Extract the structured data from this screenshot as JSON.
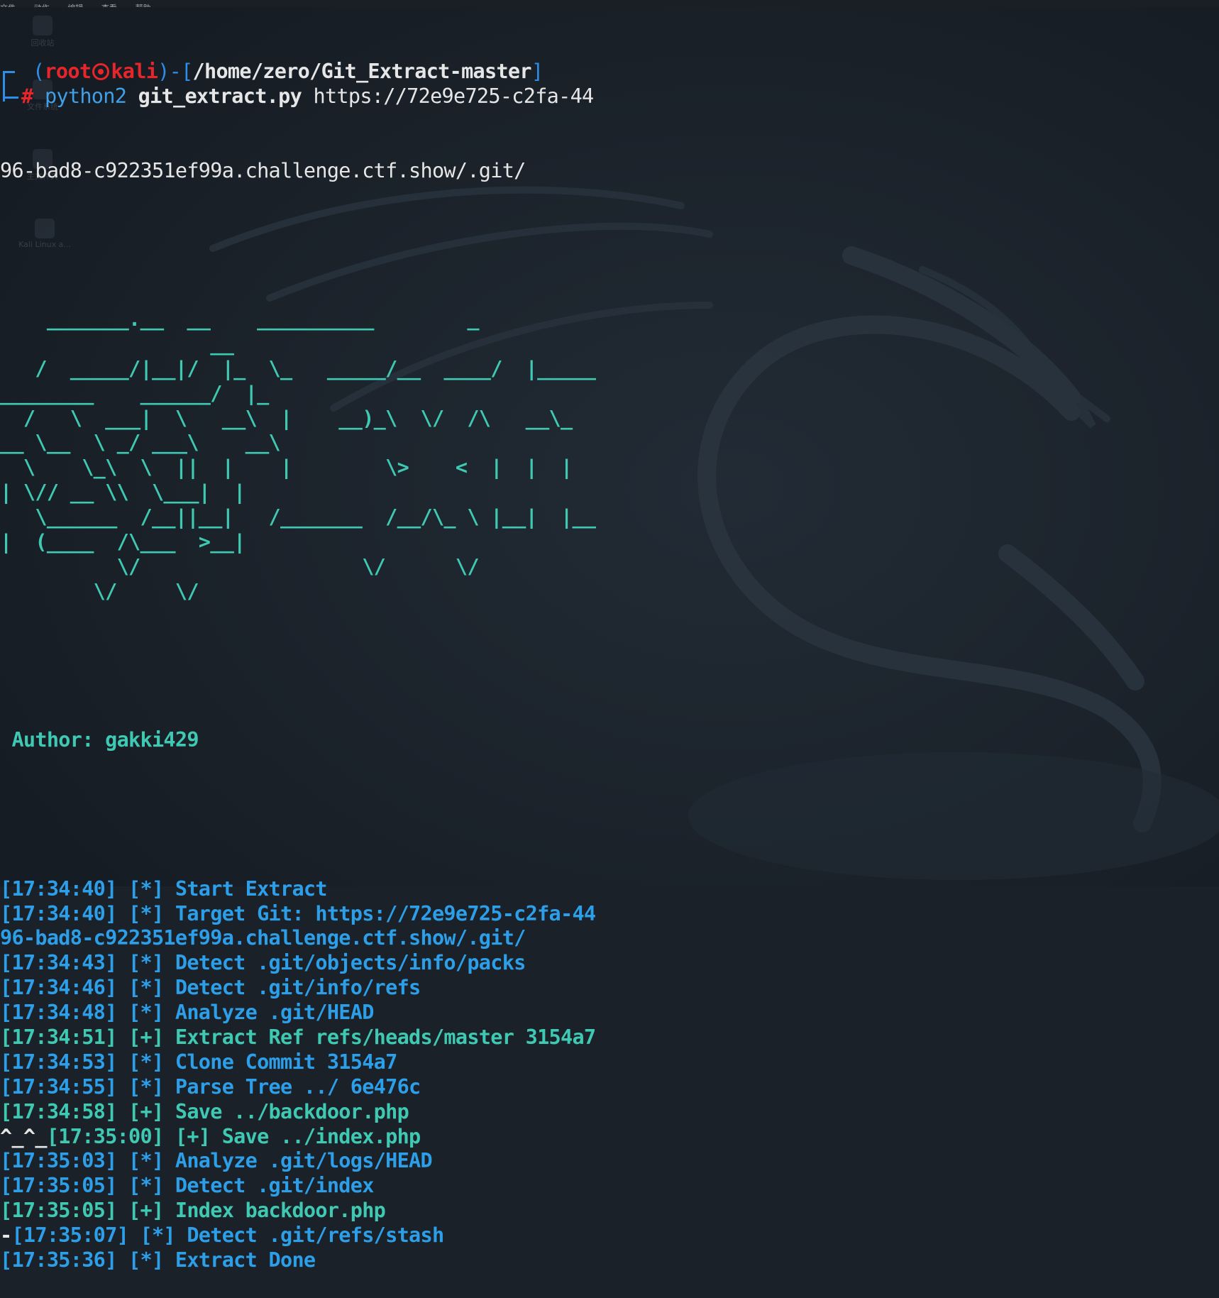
{
  "menubar": {
    "items": [
      "文件",
      "动作",
      "编辑",
      "查看",
      "帮助"
    ]
  },
  "desktop": {
    "icons": [
      "回收站",
      "文件系统",
      "主文件夹",
      "Kali Linux a..."
    ]
  },
  "prompt": {
    "open_paren": "(",
    "user": "root",
    "host": "kali",
    "close_paren_dash": ")-[",
    "path": "/home/zero/Git_Extract-master",
    "close_bracket": "]",
    "hash": "#",
    "tool": "python2",
    "script": "git_extract.py",
    "args": "https://72e9e725-c2fa-44",
    "args_wrap": "96-bad8-c922351ef99a.challenge.ctf.show/.git/"
  },
  "banner": [
    "    _______.__  __    __________        _",
    "                  __",
    "   /  _____/|__|/  |_  \\_   _____/__  ____/  |_____",
    "________    ______/  |_",
    "  /   \\  ___|  \\   __\\  |    __)_\\  \\/  /\\   __\\_",
    "__ \\__  \\ _/ ___\\    __\\",
    "  \\    \\_\\  \\  ||  |    |        \\>    <  |  |  |",
    "| \\// __ \\\\  \\___|  |",
    "   \\______  /__||__|   /_______  /__/\\_ \\ |__|  |__",
    "|  (____  /\\___  >__|",
    "          \\/                   \\/      \\/",
    "        \\/     \\/"
  ],
  "author": " Author: gakki429",
  "log": [
    {
      "text": "[17:34:40] [*] Start Extract",
      "color": "blue"
    },
    {
      "text": "[17:34:40] [*] Target Git: https://72e9e725-c2fa-44",
      "color": "blue"
    },
    {
      "text": "96-bad8-c922351ef99a.challenge.ctf.show/.git/",
      "color": "blue"
    },
    {
      "text": "[17:34:43] [*] Detect .git/objects/info/packs",
      "color": "blue"
    },
    {
      "text": "[17:34:46] [*] Detect .git/info/refs",
      "color": "blue"
    },
    {
      "text": "[17:34:48] [*] Analyze .git/HEAD",
      "color": "blue"
    },
    {
      "text": "[17:34:51] [+] Extract Ref refs/heads/master 3154a7",
      "color": "cyan"
    },
    {
      "text": "[17:34:53] [*] Clone Commit 3154a7",
      "color": "blue"
    },
    {
      "text": "[17:34:55] [*] Parse Tree ../ 6e476c",
      "color": "blue"
    },
    {
      "text": "[17:34:58] [+] Save ../backdoor.php",
      "color": "cyan"
    },
    {
      "prefix": "^_^_",
      "text": "[17:35:00] [+] Save ../index.php",
      "color": "cyan"
    },
    {
      "text": "[17:35:03] [*] Analyze .git/logs/HEAD",
      "color": "blue"
    },
    {
      "text": "[17:35:05] [*] Detect .git/index",
      "color": "blue"
    },
    {
      "text": "[17:35:05] [+] Index backdoor.php",
      "color": "cyan"
    },
    {
      "prefix": "-",
      "text": "[17:35:07] [*] Detect .git/refs/stash",
      "color": "blue"
    },
    {
      "text": "[17:35:36] [*] Extract Done",
      "color": "blue"
    }
  ]
}
